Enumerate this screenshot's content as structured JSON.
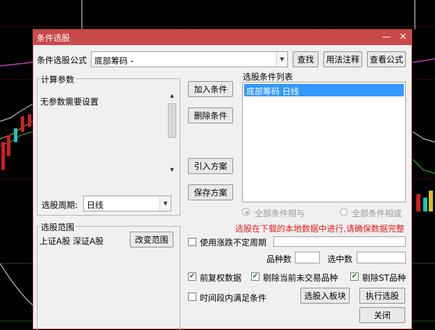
{
  "colors": {
    "title_bar": "#c9484a",
    "warning_text": "#e0201e",
    "selection": "#3399ff"
  },
  "dialog": {
    "title": "条件选股",
    "minimize_glyph": "—",
    "close_glyph": "✕",
    "formula_label": "条件选股公式",
    "formula_value": "底部筹码  -",
    "find_button": "查找",
    "usage_button": "用法注释",
    "view_formula_button": "查看公式",
    "params": {
      "title": "计算参数",
      "text": "无参数需要设置",
      "period_label": "选股周期:",
      "period_value": "日线"
    },
    "condition_buttons": {
      "add": "加入条件",
      "delete": "删除条件",
      "import_plan": "引入方案",
      "save_plan": "保存方案"
    },
    "condition_list": {
      "title": "选股条件列表",
      "items": [
        "底部筹码  日线"
      ]
    },
    "logic": {
      "and_label": "全部条件相与",
      "or_label": "全部条件相或"
    },
    "warning": "选股在下载的本地数据中进行,请确保数据完整",
    "scope": {
      "title": "选股范围",
      "value": "上证A股 深证A股",
      "change_button": "改变范围"
    },
    "uncertain_period_label": "使用涨跌不定周期",
    "count_label": "品种数",
    "selected_label": "选中数",
    "checks": {
      "restore_label": "前复权数据",
      "exclude_untraded_label": "剔除当前未交易品种",
      "exclude_st_label": "剔除ST品种",
      "time_range_label": "时间段内满足条件",
      "restore_checked": true,
      "exclude_untraded_checked": true,
      "exclude_st_checked": true,
      "time_range_checked": false
    },
    "to_block_button": "选股入板块",
    "execute_button": "执行选股",
    "close_button": "关闭"
  }
}
